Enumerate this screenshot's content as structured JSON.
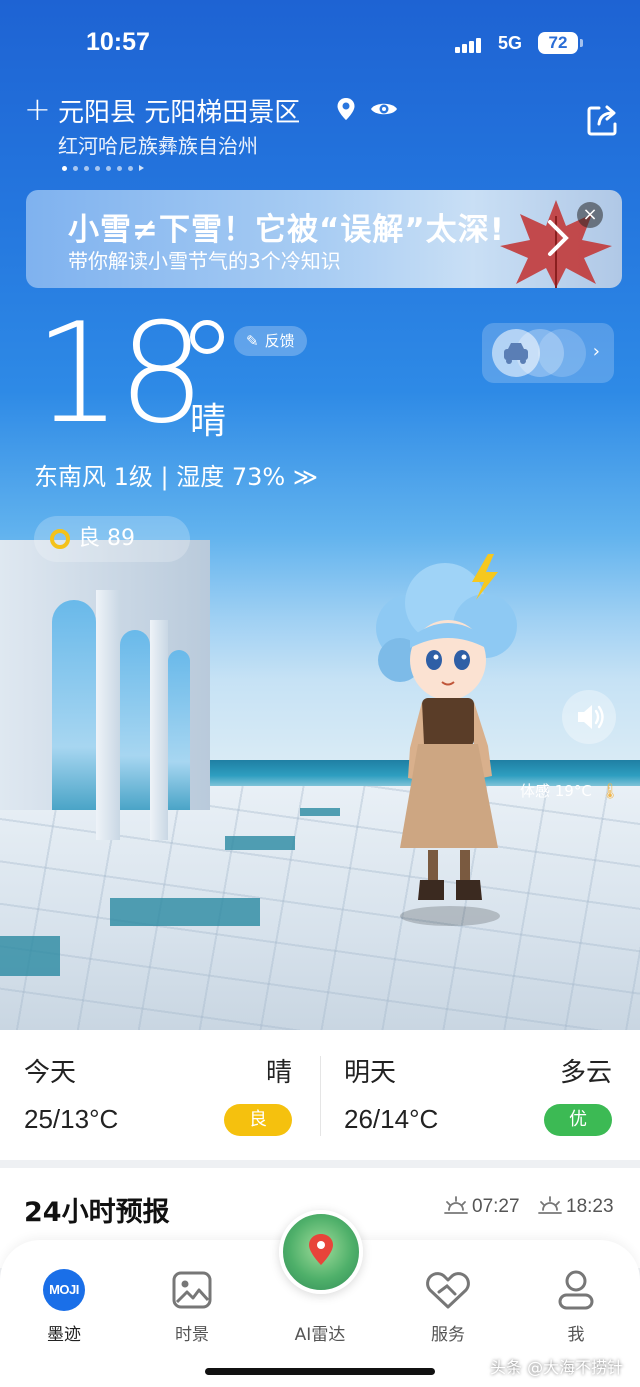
{
  "status": {
    "time": "10:57",
    "network": "5G",
    "battery": "72"
  },
  "location": {
    "name": "元阳县 元阳梯田景区",
    "sub": "红河哈尼族彝族自治州",
    "plus_icon": "plus-icon",
    "page_count": 8,
    "active_page": 1
  },
  "banner": {
    "title": "小雪≠下雪！它被“误解”太深!",
    "subtitle": "带你解读小雪节气的3个冷知识",
    "close": "×"
  },
  "current": {
    "temp": "18",
    "condition": "晴",
    "feedback": "反馈",
    "wind_humidity": "东南风 1级 | 湿度 73% ≫",
    "aqi": "良 89",
    "feels_like": "体感 19°C"
  },
  "days": [
    {
      "label": "今天",
      "condition": "晴",
      "range": "25/13°C",
      "aqi": "良",
      "aqi_color": "#f5c10e"
    },
    {
      "label": "明天",
      "condition": "多云",
      "range": "26/14°C",
      "aqi": "优",
      "aqi_color": "#3cba54"
    }
  ],
  "forecast": {
    "title": "24小时预报",
    "sunrise": "07:27",
    "sunset": "18:23"
  },
  "tabs": [
    {
      "label": "墨迹",
      "icon": "MOJI",
      "active": true
    },
    {
      "label": "时景",
      "icon": "image-icon"
    },
    {
      "label": "AI雷达",
      "icon": "radar-icon"
    },
    {
      "label": "服务",
      "icon": "service-icon"
    },
    {
      "label": "我",
      "icon": "user-icon"
    }
  ],
  "watermark": "头条 @大海不捞针"
}
